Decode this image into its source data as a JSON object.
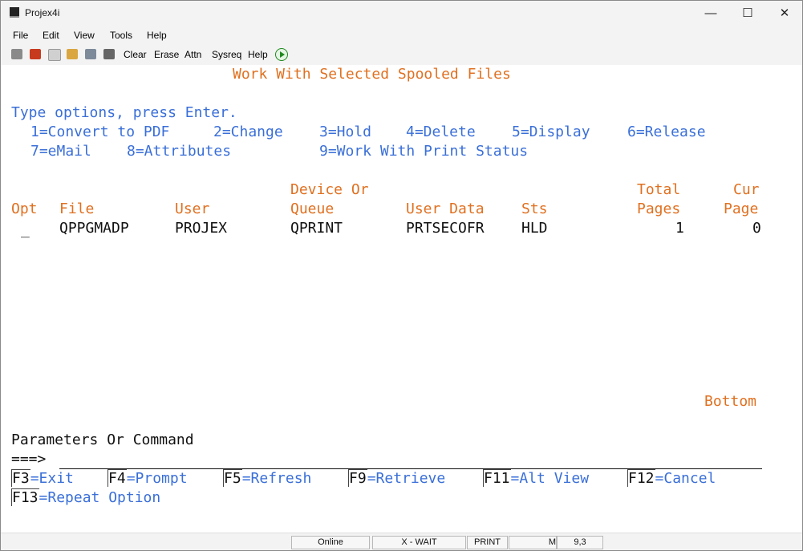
{
  "window": {
    "title": "Projex4i"
  },
  "menu": [
    "File",
    "Edit",
    "View",
    "Tools",
    "Help"
  ],
  "toolbar": {
    "buttons": [
      "Clear",
      "Erase",
      "Attn",
      "Sysreq",
      "Help"
    ]
  },
  "screen": {
    "heading": "Work With Selected Spooled Files",
    "instruction": "Type options, press Enter.",
    "options": [
      "1=Convert to PDF",
      "2=Change",
      "3=Hold",
      "4=Delete",
      "5=Display",
      "6=Release",
      "7=eMail",
      "8=Attributes",
      "9=Work With Print Status"
    ],
    "columns": {
      "opt": "Opt",
      "file": "File",
      "user": "User",
      "device_top": "Device Or",
      "device_bottom": "Queue",
      "user_data": "User Data",
      "sts": "Sts",
      "total_top": "Total",
      "total_bottom": "Pages",
      "cur_top": "Cur",
      "cur_bottom": "Page"
    },
    "rows": [
      {
        "opt": "_",
        "file": "QPPGMADP",
        "user": "PROJEX",
        "queue": "QPRINT",
        "user_data": "PRTSECOFR",
        "sts": "HLD",
        "total_pages": "1",
        "cur_page": "0"
      }
    ],
    "bottom": "Bottom",
    "params_label": "Parameters Or Command",
    "prompt": "===>",
    "fkeys": [
      {
        "key": "F3",
        "label": "=Exit"
      },
      {
        "key": "F4",
        "label": "=Prompt"
      },
      {
        "key": "F5",
        "label": "=Refresh"
      },
      {
        "key": "F9",
        "label": "=Retrieve"
      },
      {
        "key": "F11",
        "label": "=Alt View"
      },
      {
        "key": "F12",
        "label": "=Cancel"
      },
      {
        "key": "F13",
        "label": "=Repeat Option"
      }
    ]
  },
  "status": {
    "online": "Online",
    "wait": "X - WAIT",
    "print": "PRINT",
    "mode": "M",
    "cursor": "9,3"
  }
}
